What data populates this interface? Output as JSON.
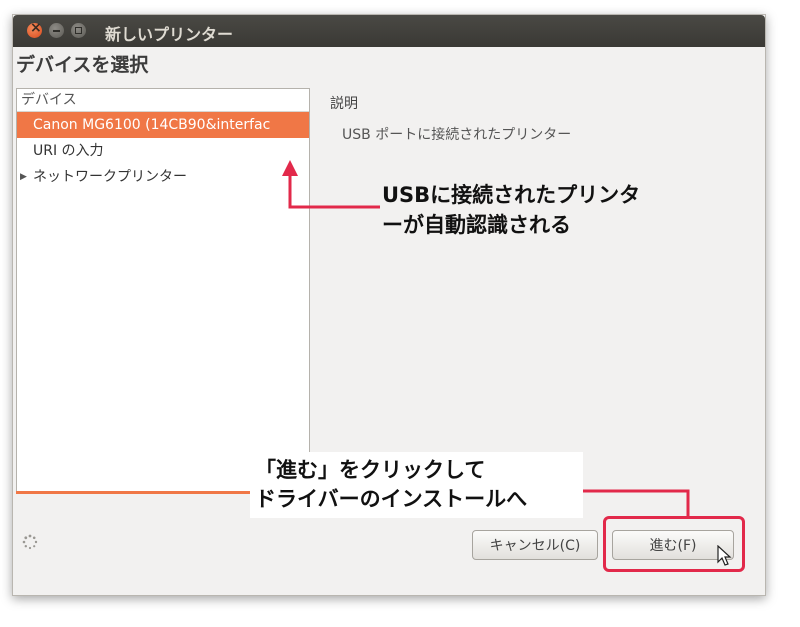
{
  "window": {
    "title": "新しいプリンター",
    "heading": "デバイスを選択"
  },
  "device_list": {
    "header": "デバイス",
    "items": [
      {
        "label": "Canon MG6100 (14CB90&interfac",
        "selected": true
      },
      {
        "label": "URI の入力",
        "selected": false
      },
      {
        "label": "ネットワークプリンター",
        "selected": false,
        "expander": "▶"
      }
    ]
  },
  "description": {
    "label": "説明",
    "text": "USB ポートに接続されたプリンター"
  },
  "buttons": {
    "cancel": "キャンセル(C)",
    "next": "進む(F)"
  },
  "annotations": {
    "usb_line1": "USBに接続されたプリンタ",
    "usb_line2": "ーが自動認識される",
    "next_line1": "「進む」をクリックして",
    "next_line2": "ドライバーのインストールへ"
  },
  "colors": {
    "accent": "#f07746",
    "annotation": "#e2294a"
  }
}
